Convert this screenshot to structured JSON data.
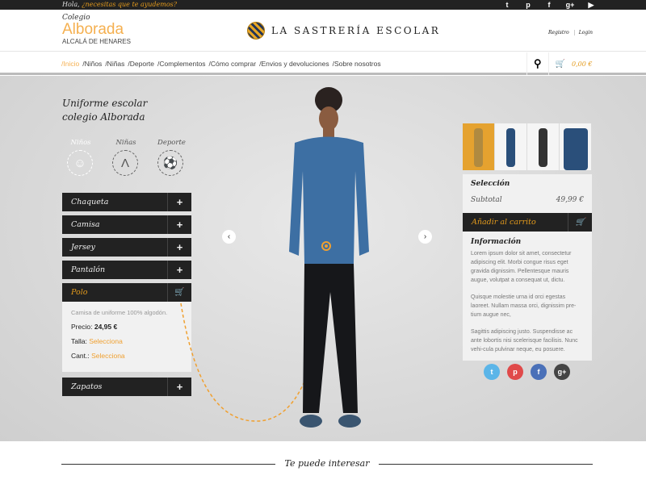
{
  "topbar": {
    "greeting_prefix": "Hola,",
    "greeting_link": "¿necesitas que te ayudemos?",
    "social": [
      "t",
      "p",
      "f",
      "g+",
      "▶"
    ]
  },
  "header": {
    "school_label": "Colegio",
    "school_name": "Alborada",
    "school_city": "ALCALÁ DE HENARES",
    "brand": "LA SASTRERÍA ESCOLAR",
    "register": "Registro",
    "login": "Login"
  },
  "nav": {
    "items": [
      "/Inicio",
      "/Niños",
      "/Niñas",
      "/Deporte",
      "/Complementos",
      "/Cómo comprar",
      "/Envios y devoluciones",
      "/Sobre nosotros"
    ],
    "cart_total": "0,00 €"
  },
  "left": {
    "title_line1": "Uniforme escolar",
    "title_line2": "colegio Alborada",
    "categories": [
      "Niños",
      "Niñas",
      "Deporte"
    ],
    "accordion": [
      "Chaqueta",
      "Camisa",
      "Jersey",
      "Pantalón",
      "Polo",
      "Zapatos"
    ],
    "polo": {
      "description": "Camisa de uniforme 100% algodón.",
      "price_label": "Precio:",
      "price": "24,95 €",
      "size_label": "Talla:",
      "size_value": "Selecciona",
      "qty_label": "Cant.:",
      "qty_value": "Selecciona"
    }
  },
  "right": {
    "selection_title": "Selección",
    "subtotal_label": "Subtotal",
    "subtotal": "49,99 €",
    "add_to_cart": "Añadir al carrito",
    "info_title": "Información",
    "info_paragraphs": [
      "Lorem ipsum dolor sit amet, consectetur adipiscing elit. Morbi congue risus eget gravida dignissim. Pellentesque mauris augue, volutpat a consequat ut, dictu.",
      "Quisque molestie urna id orci egestas laoreet. Nullam massa orci, dignissim pre-tium augue nec,",
      "Sagittis adipiscing justo. Suspendisse ac ante lobortis nisi scelerisque facilisis. Nunc vehi-cula pulvinar neque, eu posuere."
    ],
    "share": [
      "t",
      "p",
      "f",
      "g+"
    ]
  },
  "bottom": {
    "title": "Te puede interesar"
  },
  "colors": {
    "accent": "#e39a1c",
    "dark": "#222222"
  }
}
